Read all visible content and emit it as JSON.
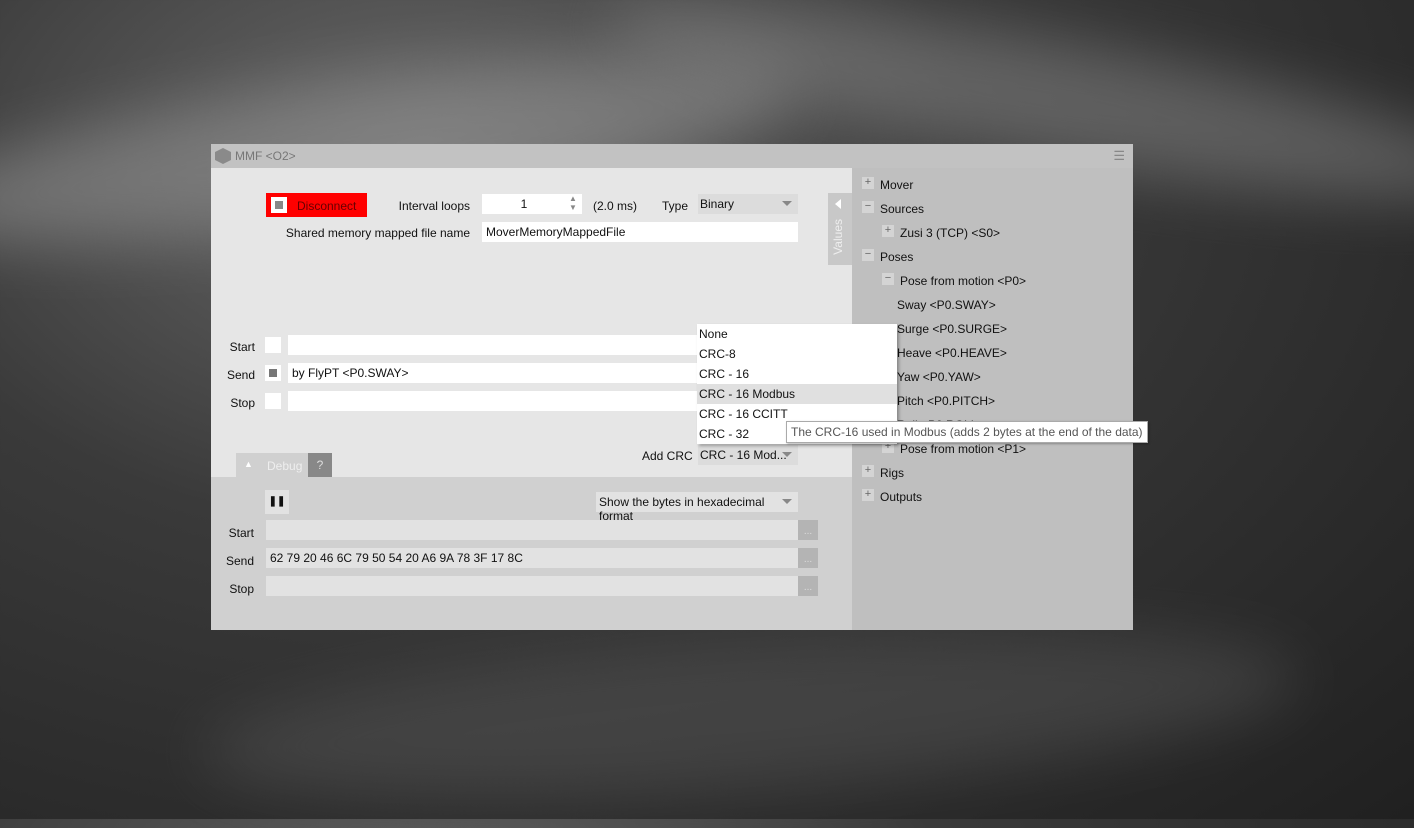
{
  "window": {
    "title": "MMF <O2>",
    "menu_icon": "hamburger-icon"
  },
  "connection": {
    "button_label": "Disconnect",
    "button_color": "#ff0000",
    "interval_label": "Interval loops",
    "interval_value": "1",
    "interval_ms": "(2.0 ms)",
    "type_label": "Type",
    "type_value": "Binary",
    "file_label": "Shared memory mapped file name",
    "file_value": "MoverMemoryMappedFile"
  },
  "values_tab": "Values",
  "messages": {
    "start_label": "Start",
    "send_label": "Send",
    "stop_label": "Stop",
    "start_value": "",
    "send_value": "by FlyPT <P0.SWAY>",
    "stop_value": "",
    "send_checked": true,
    "crc_label": "Add CRC",
    "crc_value": "CRC - 16 Mod..."
  },
  "crc_dropdown": {
    "options": [
      "None",
      "CRC-8",
      "CRC - 16",
      "CRC - 16 Modbus",
      "CRC - 16 CCITT",
      "CRC - 32"
    ],
    "highlighted": "CRC - 16 Modbus"
  },
  "tooltip": "The CRC-16 used in Modbus (adds 2 bytes at the end of the data)",
  "debug": {
    "tab_label": "Debug",
    "help_label": "?",
    "format_value": "Show the bytes in hexadecimal format",
    "start_label": "Start",
    "send_label": "Send",
    "stop_label": "Stop",
    "start_bytes": "",
    "send_bytes": "62 79 20 46 6C 79 50 54 20 A6 9A 78 3F 17 8C",
    "stop_bytes": "",
    "dots": "..."
  },
  "tree": [
    {
      "label": "Mover",
      "toggle": "+"
    },
    {
      "label": "Sources",
      "toggle": "−"
    },
    {
      "label": "Zusi 3 (TCP) <S0>",
      "toggle": "+"
    },
    {
      "label": "Poses",
      "toggle": "−"
    },
    {
      "label": "Pose from motion <P0>",
      "toggle": "−"
    },
    {
      "label": "Sway <P0.SWAY>"
    },
    {
      "label": "Surge <P0.SURGE>"
    },
    {
      "label": "Heave <P0.HEAVE>"
    },
    {
      "label": "Yaw <P0.YAW>"
    },
    {
      "label": "Pitch <P0.PITCH>"
    },
    {
      "label": "Roll <P0.ROLL>"
    },
    {
      "label": "Pose from motion <P1>",
      "toggle": "+"
    },
    {
      "label": "Rigs",
      "toggle": "+"
    },
    {
      "label": "Outputs",
      "toggle": "+"
    }
  ]
}
